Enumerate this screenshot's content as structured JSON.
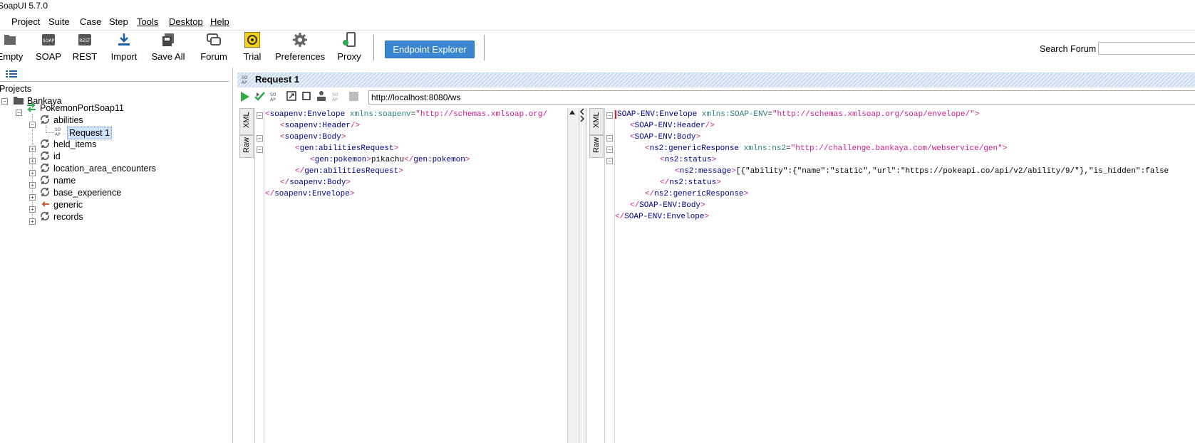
{
  "window": {
    "title": "SoapUI 5.7.0"
  },
  "menu": {
    "items": [
      "Project",
      "Suite",
      "Case",
      "Step",
      "Tools",
      "Desktop",
      "Help"
    ]
  },
  "toolbar": {
    "buttons": [
      {
        "label": "Empty",
        "icon": "empty-project-icon"
      },
      {
        "label": "SOAP",
        "icon": "soap-icon"
      },
      {
        "label": "REST",
        "icon": "rest-icon"
      },
      {
        "label": "Import",
        "icon": "import-icon"
      },
      {
        "label": "Save All",
        "icon": "save-all-icon"
      },
      {
        "label": "Forum",
        "icon": "forum-icon"
      },
      {
        "label": "Trial",
        "icon": "trial-icon"
      },
      {
        "label": "Preferences",
        "icon": "gear-icon"
      },
      {
        "label": "Proxy",
        "icon": "proxy-icon"
      }
    ],
    "endpoint_explorer": "Endpoint Explorer",
    "search_label": "Search Forum",
    "search_value": ""
  },
  "navigator": {
    "root": "Projects",
    "project": "Bankaya",
    "interface": "PokemonPortSoap11",
    "operations": [
      {
        "name": "abilities",
        "expanded": true,
        "requests": [
          "Request 1"
        ]
      },
      {
        "name": "held_items"
      },
      {
        "name": "id"
      },
      {
        "name": "location_area_encounters"
      },
      {
        "name": "name"
      },
      {
        "name": "base_experience"
      },
      {
        "name": "generic"
      },
      {
        "name": "records"
      }
    ],
    "selected": "Request 1"
  },
  "request": {
    "title": "Request 1",
    "url": "http://localhost:8080/ws",
    "tabs": {
      "xml": "XML",
      "raw": "Raw"
    }
  },
  "request_xml": {
    "l1_open": "<",
    "l1_name": "soapenv:Envelope",
    "l1_attr": " xmlns:soapenv",
    "l1_eq": "=",
    "l1_val": "\"http://schemas.xmlsoap.org/",
    "l2": "soapenv:Header",
    "l3": "soapenv:Body",
    "l4": "gen:abilitiesRequest",
    "l5_name": "gen:pokemon",
    "l5_text": "pikachu",
    "l5_close": "gen:pokemon",
    "l6": "gen:abilitiesRequest",
    "l7": "soapenv:Body",
    "l8": "soapenv:Envelope"
  },
  "response_xml": {
    "l1_name": "SOAP-ENV:Envelope",
    "l1_attr": " xmlns:SOAP-ENV",
    "l1_val": "\"http://schemas.xmlsoap.org/soap/envelope/\"",
    "l2": "SOAP-ENV:Header",
    "l3": "SOAP-ENV:Body",
    "l4_name": "ns2:genericResponse",
    "l4_attr": " xmlns:ns2",
    "l4_val": "\"http://challenge.bankaya.com/webservice/gen\"",
    "l5": "ns2:status",
    "l6_name": "ns2:message",
    "l6_text": "[{\"ability\":{\"name\":\"static\",\"url\":\"https://pokeapi.co/api/v2/ability/9/\"},\"is_hidden\":false",
    "l7": "ns2:status",
    "l8": "ns2:genericResponse",
    "l9": "SOAP-ENV:Body",
    "l10": "SOAP-ENV:Envelope"
  },
  "colors": {
    "accent": "#3b86d1",
    "selection": "#cfe1f7",
    "xml_bracket": "#d11d8c",
    "xml_name": "#00008b"
  }
}
